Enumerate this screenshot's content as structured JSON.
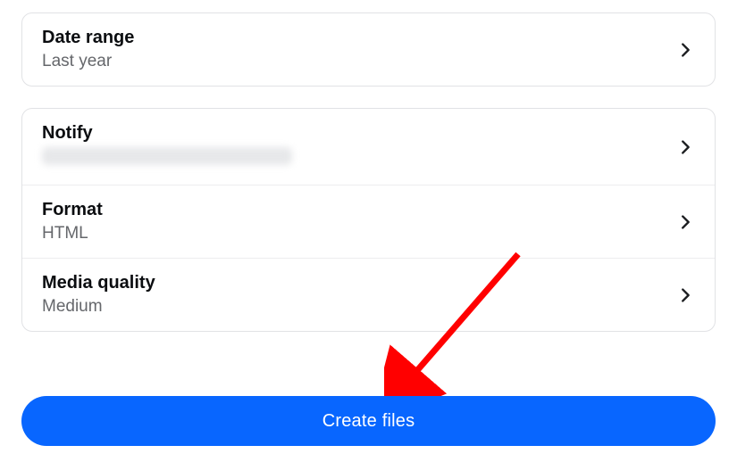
{
  "sections": {
    "dateRange": {
      "title": "Date range",
      "value": "Last year"
    },
    "notify": {
      "title": "Notify",
      "value": ""
    },
    "format": {
      "title": "Format",
      "value": "HTML"
    },
    "quality": {
      "title": "Media quality",
      "value": "Medium"
    }
  },
  "cta": {
    "label": "Create files"
  },
  "colors": {
    "accent": "#0866ff"
  }
}
